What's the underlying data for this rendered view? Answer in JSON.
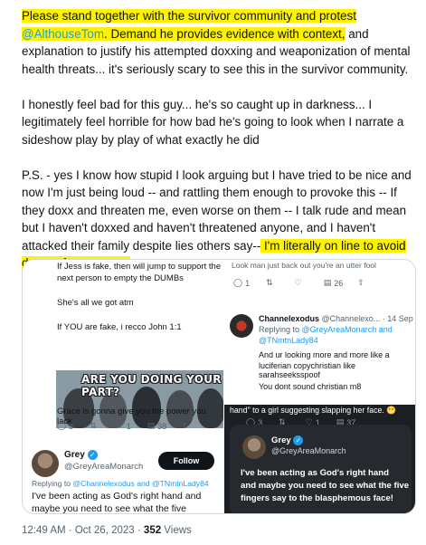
{
  "tweet": {
    "p1_hl1": "Please stand together with the survivor community and protest",
    "p1_mention": "@AlthouseTom",
    "p1_hl2": ". Demand he provides evidence with context,",
    "p1_rest": " and explanation to justify his attempted doxxing and weaponization of mental health threats... it's seriously scary to see this in the survivor community.",
    "p2": "I honestly feel bad for this guy... he's so caught up in darkness... I legitimately feel horrible for how bad he's going to look when I narrate a sideshow play by play of what exactly he did",
    "p3_main": "P.S. - yes I know how stupid I look arguing but I have tried to be nice and now I'm just being loud -- and rattling them enough to provoke this -- If they doxx and threaten me, even worse on them -- I talk rude and mean but I haven't doxxed and haven't threatened anyone, and I haven't attacked their family despite lies others say--",
    "p3_hl": " I'm literally on line to avoid danger for everyone"
  },
  "screenshot_left": {
    "line1": "If Jess is fake, then will jump to support the",
    "line2": "next person to empty the DUMBs",
    "line3": "She's all we got atm",
    "line4": "If YOU are fake, i recco John 1:1",
    "meme_caption": "ARE YOU DOING YOUR PART?",
    "line5": "Grace is gonna give you the power you lack",
    "stats": {
      "replies": "3",
      "retweets": "",
      "likes": "1",
      "views": "38"
    },
    "author_name": "Grey",
    "author_handle": "@GreyAreaMonarch",
    "follow_label": "Follow",
    "replying_prefix": "Replying to ",
    "replying_handles": "@Channelexodus and @TNmtnLady84",
    "reply_text_1": "I've been acting as God's right hand and",
    "reply_text_2": "maybe you need to see what the five"
  },
  "screenshot_right_top": {
    "top_line": "Look man just back out you're an utter fool",
    "top_stats": {
      "replies": "1",
      "retweets": "",
      "likes": "",
      "views": "26"
    },
    "author_name": "Channelexodus",
    "author_handle": "@Channelexo...",
    "date": "· 14 Sep",
    "replying_prefix": "Replying to ",
    "replying_handles": "@GreyAreaMonarch and @TNmtnLady84",
    "text_1": "And ur looking more and more like a",
    "text_2": "luciferian copychristian like sarahseeksspoof",
    "text_3": "You dont sound christian m8"
  },
  "screenshot_right_bottom": {
    "top_line": "hand\" to a girl suggesting slapping her face.",
    "emoji": "😬",
    "stats": {
      "replies": "3",
      "likes": "1",
      "views": "37"
    },
    "author_name": "Grey",
    "author_handle": "@GreyAreaMonarch",
    "text_1": "I've been acting as God's right hand",
    "text_2": "and maybe you need to see what the five",
    "text_3": "fingers say to the blasphemous face!"
  },
  "meta": {
    "time": "12:49 AM",
    "sep": " · ",
    "date": "Oct 26, 2023",
    "views_count": "352",
    "views_label": " Views"
  },
  "colors": {
    "highlight": "#fef200",
    "mention": "#1d9bf0",
    "text": "#0f1419",
    "muted": "#536471"
  },
  "icons": [
    "reply-icon",
    "retweet-icon",
    "like-icon",
    "views-icon",
    "share-icon",
    "verified-icon"
  ]
}
